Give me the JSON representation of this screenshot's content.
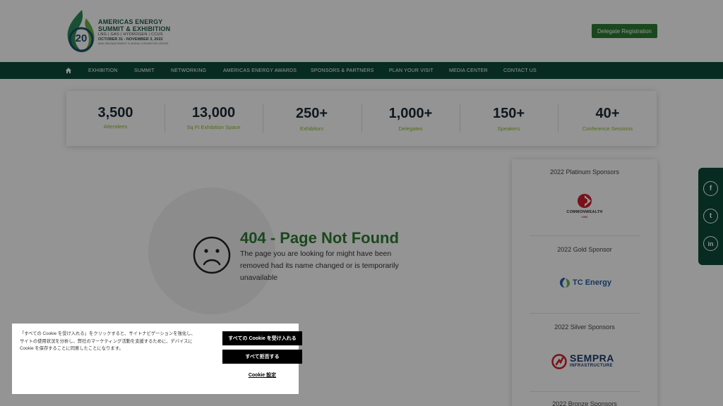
{
  "header": {
    "logo": {
      "number": "20",
      "title_line1": "AMERICAS ENERGY",
      "title_line2": "SUMMIT & EXHIBITION",
      "tagline": "LNG | GAS | HYDROGEN | CCUS",
      "dates": "OCTOBER 31 - NOVEMBER 3, 2022",
      "venue": "NEW ORLEANS ERNEST N. MORIAL CONVENTION CENTER"
    },
    "register_label": "Delegate Registration"
  },
  "nav": {
    "items": [
      "EXHIBITION",
      "SUMMIT",
      "NETWORKING",
      "AMERICAS ENERGY AWARDS",
      "SPONSORS & PARTNERS",
      "PLAN YOUR VISIT",
      "MEDIA CENTER",
      "CONTACT US"
    ]
  },
  "stats": [
    {
      "value": "3,500",
      "label": "Attendees"
    },
    {
      "value": "13,000",
      "label": "Sq Ft Exhibition Space"
    },
    {
      "value": "250+",
      "label": "Exhibitors"
    },
    {
      "value": "1,000+",
      "label": "Delegates"
    },
    {
      "value": "150+",
      "label": "Speakers"
    },
    {
      "value": "40+",
      "label": "Conference Sessions"
    }
  ],
  "error": {
    "title": "404 - Page Not Found",
    "message": "The page you are looking for might have been removed had its name changed or is temporarily unavailable"
  },
  "sponsors": {
    "platinum_heading": "2022 Platinum Sponsors",
    "platinum_name": "COMMONWEALTH",
    "platinum_sub": "LNG",
    "gold_heading": "2022 Gold Sponsor",
    "gold_name": "TC Energy",
    "silver_heading": "2022 Silver Sponsors",
    "silver_name": "SEMPRA",
    "silver_sub": "INFRASTRUCTURE",
    "bronze_heading": "2022 Bronze Sponsors"
  },
  "social": {
    "facebook": "f",
    "twitter": "t",
    "linkedin": "in"
  },
  "cookie": {
    "text": "「すべての Cookie を受け入れる」をクリックすると、サイトナビゲーションを強化し、サイトの使用状況を分析し、弊社のマーケティング活動を支援するために、デバイスに Cookie を保存することに同意したことになります。",
    "accept_label": "すべての Cookie を受け入れる",
    "reject_label": "すべて拒否する",
    "settings_label": "Cookie 設定"
  },
  "colors": {
    "brand_green": "#2e7d32",
    "nav_dark_green": "#0d4a3a",
    "stat_label_green": "#8bbb24"
  }
}
